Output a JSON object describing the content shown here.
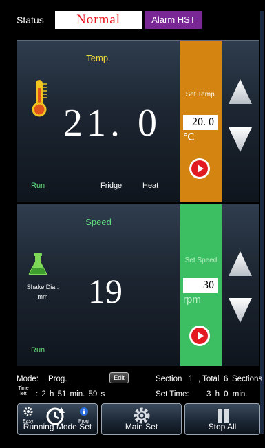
{
  "status": {
    "label": "Status",
    "value": "Normal",
    "alarm_label": "Alarm HST"
  },
  "temperature": {
    "title": "Temp.",
    "current": "21. 0",
    "set_title": "Set Temp.",
    "set_value": "20. 0",
    "unit": "℃",
    "run_label": "Run",
    "fridge_label": "Fridge",
    "heat_label": "Heat"
  },
  "speed": {
    "title": "Speed",
    "current": "19",
    "set_title": "Set Speed",
    "set_value": "30",
    "unit": "rpm",
    "run_label": "Run",
    "shake_label": "Shake Dia.:",
    "shake_unit": "mm"
  },
  "info": {
    "mode_label": "Mode:",
    "mode_value": "Prog.",
    "edit_label": "Edit",
    "section_label": "Section",
    "section_value": "1",
    "total_label": ", Total",
    "total_value": "6",
    "sections_label": "Sections",
    "time_left_label_1": "Time",
    "time_left_label_2": "left",
    "time_left_value": ": 2 h 51 min. 59 s",
    "set_time_label": "Set Time:",
    "set_time_value": "3 h 0 min."
  },
  "buttons": {
    "running_mode": "Running Mode Set",
    "easy": "Easy",
    "prog": "Prog",
    "main_set": "Main Set",
    "stop_all": "Stop All"
  },
  "colors": {
    "temp_accent": "#d38411",
    "speed_accent": "#3cbf63",
    "alarm": "#7a2796",
    "status_text": "#e6141e"
  }
}
